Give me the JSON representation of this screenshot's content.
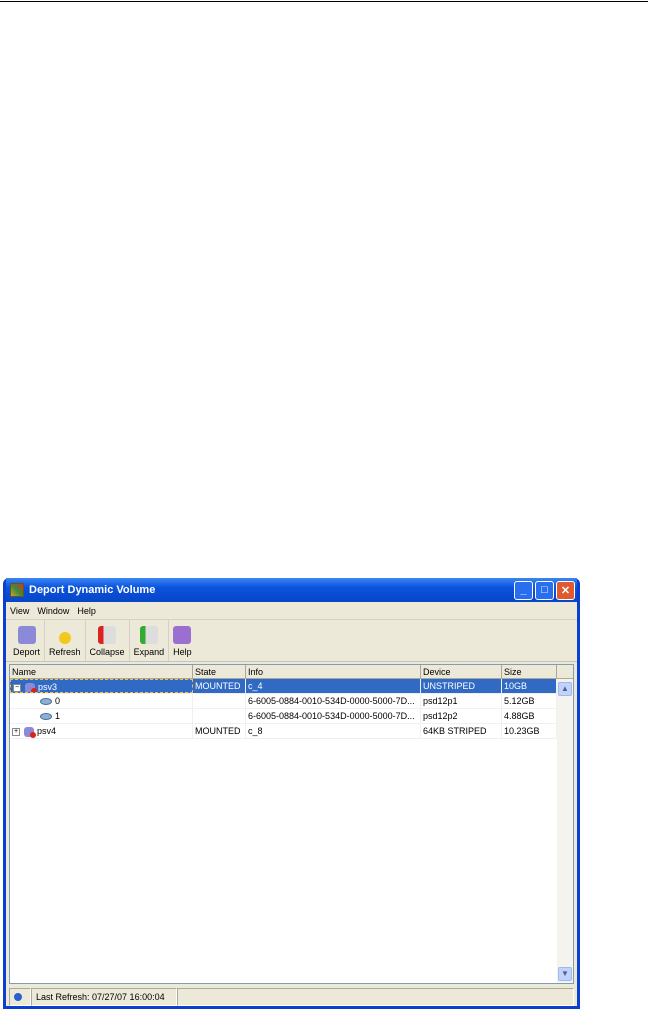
{
  "window": {
    "title": "Deport Dynamic Volume"
  },
  "menu": [
    "View",
    "Window",
    "Help"
  ],
  "toolbar": [
    "Deport",
    "Refresh",
    "Collapse",
    "Expand",
    "Help"
  ],
  "columns": [
    "Name",
    "State",
    "Info",
    "Device",
    "Size"
  ],
  "rows": [
    {
      "name": "psv3",
      "state": "MOUNTED",
      "info": "c_4",
      "device": "UNSTRIPED",
      "size": "10GB"
    },
    {
      "name": "0",
      "state": "",
      "info": "6-6005-0884-0010-534D-0000-5000-7D...",
      "device": "psd12p1",
      "size": "5.12GB"
    },
    {
      "name": "1",
      "state": "",
      "info": "6-6005-0884-0010-534D-0000-5000-7D...",
      "device": "psd12p2",
      "size": "4.88GB"
    },
    {
      "name": "psv4",
      "state": "MOUNTED",
      "info": "c_8",
      "device": "64KB STRIPED",
      "size": "10.23GB"
    }
  ],
  "status": {
    "text": "Last Refresh: 07/27/07 16:00:04"
  }
}
